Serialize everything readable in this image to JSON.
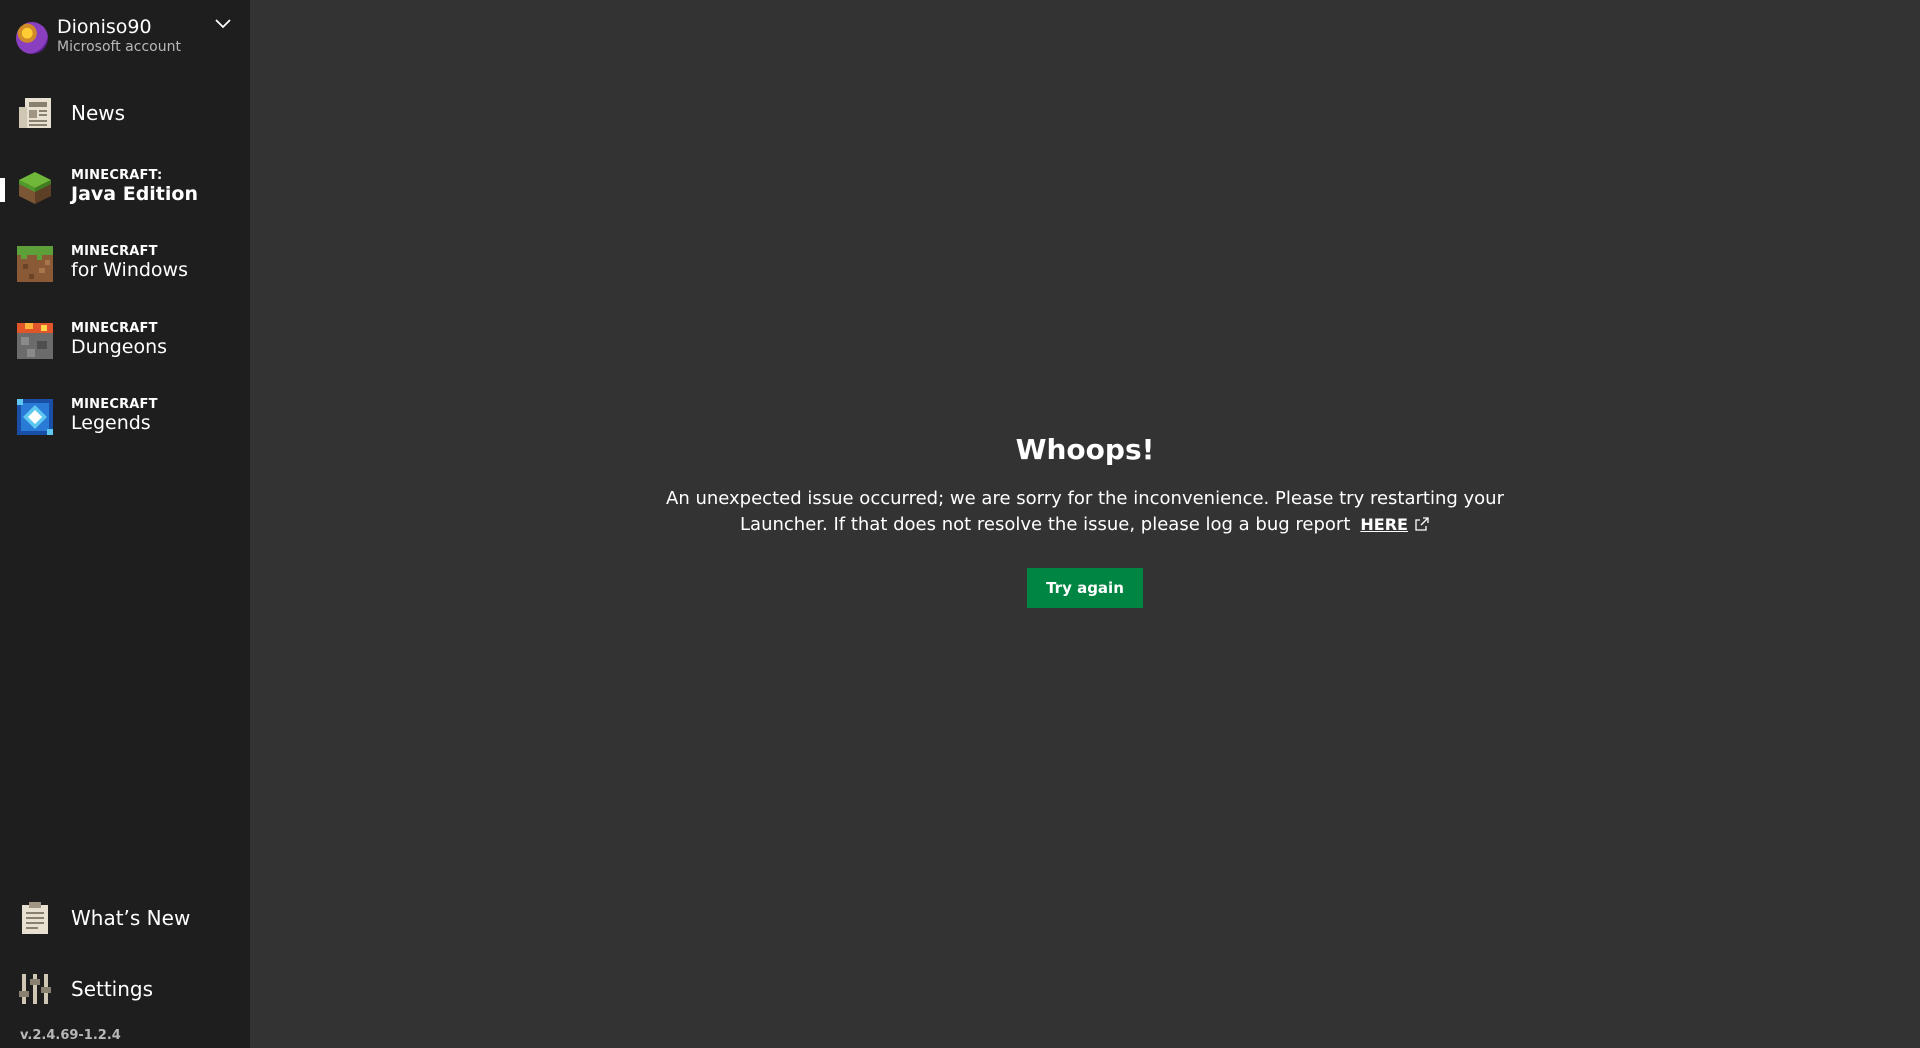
{
  "account": {
    "name": "Dioniso90",
    "type": "Microsoft account"
  },
  "nav": {
    "news": "News",
    "java": {
      "brand": "MINECRAFT:",
      "title": "Java Edition"
    },
    "windows": {
      "brand": "MINECRAFT",
      "title": "for Windows"
    },
    "dungeons": {
      "brand": "MINECRAFT",
      "title": "Dungeons"
    },
    "legends": {
      "brand": "MINECRAFT",
      "title": "Legends"
    },
    "whats_new": "What’s New",
    "settings": "Settings"
  },
  "version": "v.2.4.69-1.2.4",
  "error": {
    "title": "Whoops!",
    "message": "An unexpected issue occurred; we are sorry for the inconvenience. Please try restarting your Launcher. If that does not resolve the issue, please log a bug report",
    "link_label": "HERE",
    "button_label": "Try again"
  },
  "colors": {
    "sidebar_bg": "#1e1e1e",
    "main_bg": "#333333",
    "button_green": "#008542"
  }
}
